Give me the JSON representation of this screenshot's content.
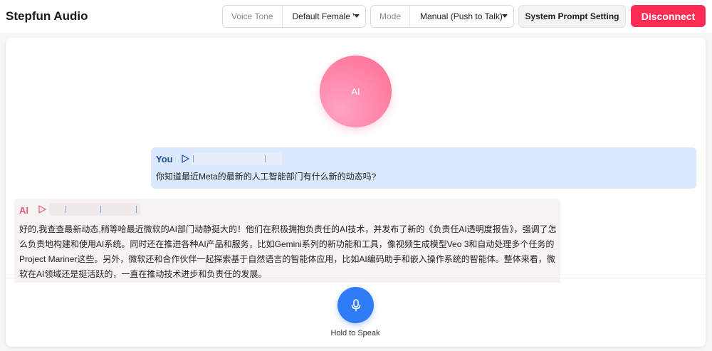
{
  "header": {
    "app_title": "Stepfun Audio",
    "voice_tone": {
      "label": "Voice Tone",
      "value": "Default Female V"
    },
    "mode": {
      "label": "Mode",
      "value": "Manual (Push to Talk)"
    },
    "system_prompt_label": "System Prompt Setting",
    "disconnect_label": "Disconnect"
  },
  "avatar": {
    "label": "AI"
  },
  "messages": [
    {
      "sender": "You",
      "text": "你知道最近Meta的最新的人工智能部门有什么新的动态吗?"
    },
    {
      "sender": "AI",
      "text": "好的,我查查最新动态,稍等哈最近微软的AI部门动静挺大的！他们在积极拥抱负责任的AI技术，并发布了新的《负责任AI透明度报告》，强调了怎么负责地构建和使用AI系统。同时还在推进各种AI产品和服务，比如Gemini系列的新功能和工具，像视频生成模型Veo 3和自动处理多个任务的Project Mariner这些。另外，微软还和合作伙伴一起探索基于自然语言的智能体应用，比如AI编码助手和嵌入操作系统的智能体。整体来看，微软在AI领域还是挺活跃的，一直在推动技术进步和负责任的发展。"
    }
  ],
  "mic": {
    "caption": "Hold to Speak",
    "icon": "microphone-icon"
  },
  "colors": {
    "accent_red": "#ff2d55",
    "mic_blue": "#2f7cf6",
    "user_bubble": "#dbe9ff",
    "ai_bubble": "#f7f3f4"
  }
}
